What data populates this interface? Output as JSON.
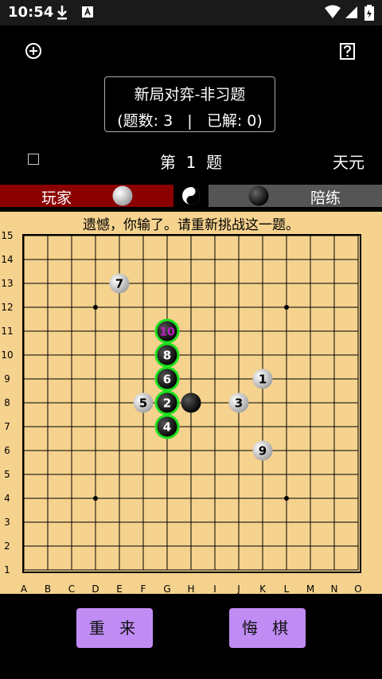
{
  "status_bar": {
    "time": "10:54"
  },
  "header": {
    "title": "新局对弈-非习题",
    "stats": "(题数: 3   |   已解: 0)",
    "problem_label": "第  1  题",
    "opening": "天元"
  },
  "players": {
    "player_label": "玩家",
    "trainer_label": "陪练"
  },
  "board": {
    "message": "遗憾，你输了。请重新挑战这一题。",
    "columns": [
      "A",
      "B",
      "C",
      "D",
      "E",
      "F",
      "G",
      "H",
      "I",
      "J",
      "K",
      "L",
      "M",
      "N",
      "O"
    ],
    "rows": [
      "15",
      "14",
      "13",
      "12",
      "11",
      "10",
      "9",
      "8",
      "7",
      "6",
      "5",
      "4",
      "3",
      "2",
      "1"
    ],
    "stones": [
      {
        "col": "K",
        "row": 9,
        "color": "white",
        "label": "1"
      },
      {
        "col": "G",
        "row": 8,
        "color": "black",
        "label": "2",
        "highlight": true
      },
      {
        "col": "J",
        "row": 8,
        "color": "white",
        "label": "3"
      },
      {
        "col": "G",
        "row": 7,
        "color": "black",
        "label": "4",
        "highlight": true
      },
      {
        "col": "F",
        "row": 8,
        "color": "white",
        "label": "5"
      },
      {
        "col": "G",
        "row": 9,
        "color": "black",
        "label": "6",
        "highlight": true
      },
      {
        "col": "E",
        "row": 13,
        "color": "white",
        "label": "7"
      },
      {
        "col": "G",
        "row": 10,
        "color": "black",
        "label": "8",
        "highlight": true
      },
      {
        "col": "K",
        "row": 6,
        "color": "white",
        "label": "9"
      },
      {
        "col": "G",
        "row": 11,
        "color": "black",
        "label": "10",
        "highlight": true,
        "label_color": "#c020c0"
      },
      {
        "col": "H",
        "row": 8,
        "color": "black",
        "label": ""
      }
    ],
    "star_points": [
      [
        "D",
        12
      ],
      [
        "L",
        12
      ],
      [
        "D",
        4
      ],
      [
        "L",
        4
      ]
    ]
  },
  "buttons": {
    "restart": "重 来",
    "undo": "悔 棋"
  }
}
